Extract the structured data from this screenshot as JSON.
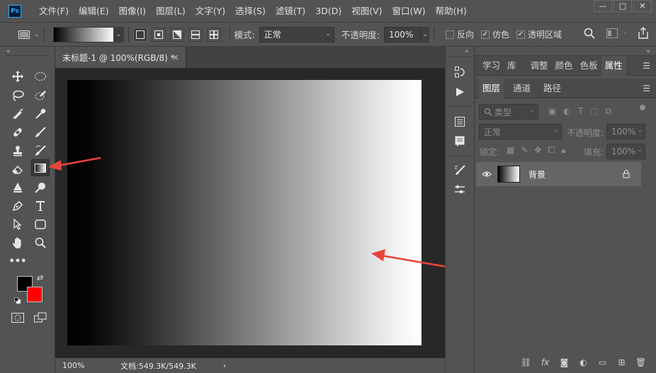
{
  "app": {
    "logo_text": "Ps"
  },
  "menu": [
    "文件(F)",
    "编辑(E)",
    "图像(I)",
    "图层(L)",
    "文字(Y)",
    "选择(S)",
    "滤镜(T)",
    "3D(D)",
    "视图(V)",
    "窗口(W)",
    "帮助(H)"
  ],
  "window_controls": {
    "minimize": "—",
    "maximize": "□",
    "close": "✕"
  },
  "options": {
    "mode_label": "模式:",
    "mode_value": "正常",
    "opacity_label": "不透明度:",
    "opacity_value": "100%",
    "reverse_label": "反向",
    "dither_label": "仿色",
    "transparency_label": "透明区域",
    "reverse_checked": false,
    "dither_checked": true,
    "transparency_checked": true
  },
  "document": {
    "tab_title": "未标题-1 @ 100%(RGB/8) *",
    "tab_close": "×",
    "zoom": "100%",
    "doc_info": "文档:549.3K/549.3K",
    "status_arrow": "›"
  },
  "colors": {
    "foreground": "#000000",
    "background": "#ff0000",
    "annotation_arrow": "#e8443a"
  },
  "right_panel": {
    "top_tabs": [
      "学习",
      "库",
      "调整",
      "颜色",
      "色板",
      "属性"
    ],
    "active_top_tab": "属性",
    "layer_tabs": [
      "图层",
      "通道",
      "路径"
    ],
    "active_layer_tab": "图层",
    "filter_label": "类型",
    "blend_mode": "正常",
    "opacity_label": "不透明度:",
    "opacity_value": "100%",
    "lock_label": "锁定:",
    "fill_label": "填充:",
    "fill_value": "100%",
    "layers": [
      {
        "name": "背景",
        "visible": true,
        "locked": true
      }
    ]
  },
  "footer_icons": [
    "link-icon",
    "fx-icon",
    "mask-icon",
    "adjustment-icon",
    "folder-icon",
    "new-layer-icon",
    "trash-icon"
  ]
}
